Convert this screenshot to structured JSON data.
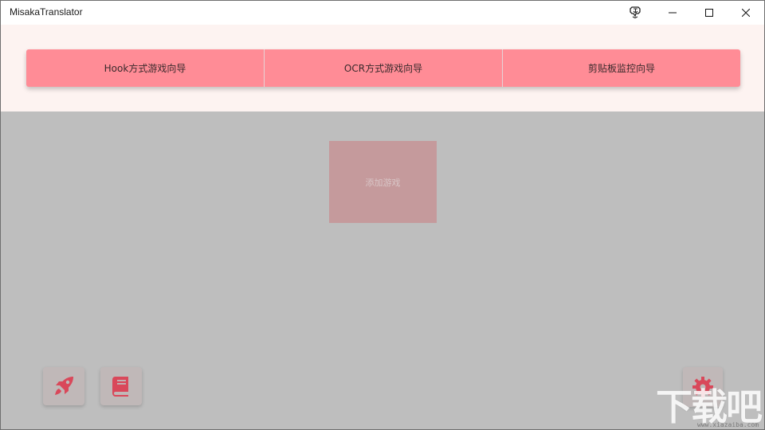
{
  "window": {
    "title": "MisakaTranslator"
  },
  "wizard": {
    "hook_label": "Hook方式游戏向导",
    "ocr_label": "OCR方式游戏向导",
    "clipboard_label": "剪贴板监控向导"
  },
  "main": {
    "add_game_label": "添加游戏"
  },
  "watermark": {
    "text": "下载吧",
    "url": "www.xiazaiba.com"
  },
  "colors": {
    "accent": "#ff8c96",
    "icon_red": "#d9485a",
    "header_bg": "#fdf3f1",
    "overlay_bg": "#bebebe"
  }
}
